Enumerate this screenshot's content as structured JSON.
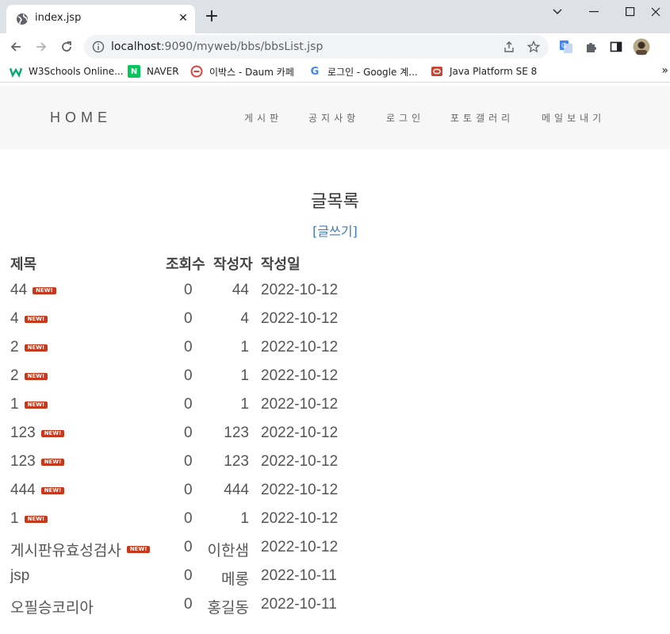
{
  "browser": {
    "tab_title": "index.jsp",
    "url_host": "localhost",
    "url_rest": ":9090/myweb/bbs/bbsList.jsp",
    "bookmarks": [
      {
        "label": "W3Schools Online..."
      },
      {
        "label": "NAVER"
      },
      {
        "label": "이박스 - Daum 카페"
      },
      {
        "label": "로그인 - Google 계..."
      },
      {
        "label": "Java Platform SE 8"
      }
    ],
    "bookmarks_more": "»",
    "new_tab": "+",
    "tab_close": "✕",
    "colors": {
      "tabbar": "#dee1e6",
      "omnibox": "#f1f3f4"
    }
  },
  "site": {
    "brand": "HOME",
    "menu": [
      {
        "label": "게시판"
      },
      {
        "label": "공지사항"
      },
      {
        "label": "로그인"
      },
      {
        "label": "포토갤러리"
      },
      {
        "label": "메일보내기"
      }
    ]
  },
  "board": {
    "title": "글목록",
    "write_link": "[글쓰기]",
    "headers": {
      "title": "제목",
      "views": "조회수",
      "writer": "작성자",
      "date": "작성일"
    },
    "new_badge": "NEW!",
    "rows": [
      {
        "title": "44",
        "is_new": true,
        "views": "0",
        "writer": "44",
        "date": "2022-10-12"
      },
      {
        "title": "4",
        "is_new": true,
        "views": "0",
        "writer": "4",
        "date": "2022-10-12"
      },
      {
        "title": "2",
        "is_new": true,
        "views": "0",
        "writer": "1",
        "date": "2022-10-12"
      },
      {
        "title": "2",
        "is_new": true,
        "views": "0",
        "writer": "1",
        "date": "2022-10-12"
      },
      {
        "title": "1",
        "is_new": true,
        "views": "0",
        "writer": "1",
        "date": "2022-10-12"
      },
      {
        "title": "123",
        "is_new": true,
        "views": "0",
        "writer": "123",
        "date": "2022-10-12"
      },
      {
        "title": "123",
        "is_new": true,
        "views": "0",
        "writer": "123",
        "date": "2022-10-12"
      },
      {
        "title": "444",
        "is_new": true,
        "views": "0",
        "writer": "444",
        "date": "2022-10-12"
      },
      {
        "title": "1",
        "is_new": true,
        "views": "0",
        "writer": "1",
        "date": "2022-10-12"
      },
      {
        "title": "게시판유효성검사",
        "is_new": true,
        "views": "0",
        "writer": "이한샘",
        "date": "2022-10-12"
      },
      {
        "title": "jsp",
        "is_new": false,
        "views": "0",
        "writer": "메롱",
        "date": "2022-10-11"
      },
      {
        "title": "오필승코리아",
        "is_new": false,
        "views": "0",
        "writer": "홍길동",
        "date": "2022-10-11"
      }
    ],
    "colors": {
      "badge": "#c8381c",
      "link": "#3a7bbf"
    }
  }
}
